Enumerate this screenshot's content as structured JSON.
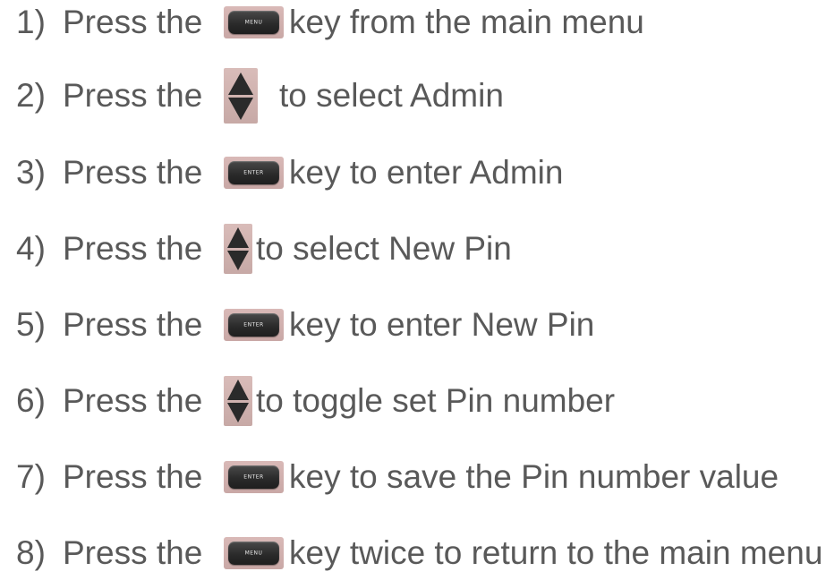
{
  "steps": [
    {
      "number": "1)",
      "lead": "Press the",
      "icon": "menu-key",
      "key_label": "MENU",
      "text": "key from the main menu"
    },
    {
      "number": "2)",
      "lead": "Press the",
      "icon": "up-down-arrow-key",
      "text": "to select Admin"
    },
    {
      "number": "3)",
      "lead": "Press the",
      "icon": "enter-key",
      "key_label": "ENTER",
      "text": "key to enter Admin"
    },
    {
      "number": "4)",
      "lead": "Press the",
      "icon": "up-down-arrow-key",
      "text": "to select New Pin"
    },
    {
      "number": "5)",
      "lead": "Press the",
      "icon": "enter-key",
      "key_label": "ENTER",
      "text": "key to enter New Pin"
    },
    {
      "number": "6)",
      "lead": "Press the",
      "icon": "up-down-arrow-key",
      "text": "to toggle set Pin number"
    },
    {
      "number": "7)",
      "lead": "Press the",
      "icon": "enter-key",
      "key_label": "ENTER",
      "text": "key to save the Pin number value"
    },
    {
      "number": "8)",
      "lead": "Press the",
      "icon": "menu-key",
      "key_label": "MENU",
      "text": "key twice to return to the main menu"
    }
  ]
}
